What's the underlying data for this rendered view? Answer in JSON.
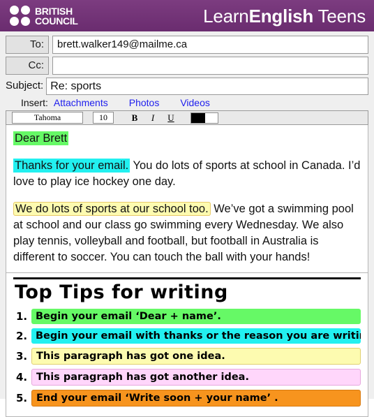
{
  "header": {
    "logo_line1": "BRITISH",
    "logo_line2": "COUNCIL",
    "brand_pre": "Learn",
    "brand_bold": "English",
    "brand_post": " Teens",
    "bg_color": "#6f3073"
  },
  "mail": {
    "to_label": "To:",
    "to_value": "brett.walker149@mailme.ca",
    "cc_label": "Cc:",
    "cc_value": "",
    "subject_label": "Subject:",
    "subject_value": "Re: sports",
    "insert_label": "Insert:",
    "insert_links": [
      "Attachments",
      "Photos",
      "Videos"
    ]
  },
  "toolbar": {
    "font_name": "Tahoma",
    "font_size": "10",
    "bold": "B",
    "italic": "I",
    "underline": "U",
    "color_value": "#000000"
  },
  "body": {
    "greeting_highlight": "Dear Brett",
    "p2_highlight": "Thanks for your email.",
    "p2_rest": " You do lots of sports at school in Canada. I’d love to play ice hockey one day.",
    "p3_highlight": "We do lots of sports at our school too.",
    "p3_rest": " We’ve got a swimming pool at school and our class go swimming every Wednesday. We also play tennis, volleyball and football, but football in Australia is different to soccer. You can touch the ball with your hands!"
  },
  "tips": {
    "title": "Top Tips for writing",
    "items": [
      {
        "num": "1.",
        "text": "Begin your email ‘Dear + name’.",
        "color": "#66f966"
      },
      {
        "num": "2.",
        "text": "Begin your email with thanks or the reason you are writing.",
        "color": "#22f0f0"
      },
      {
        "num": "3.",
        "text": "This paragraph has got one idea.",
        "color": "#fdfbb0"
      },
      {
        "num": "4.",
        "text": "This paragraph has got another idea.",
        "color": "#ffd6fb"
      },
      {
        "num": "5.",
        "text": "End your email ‘Write soon + your name’ .",
        "color": "#f7941e"
      }
    ]
  }
}
